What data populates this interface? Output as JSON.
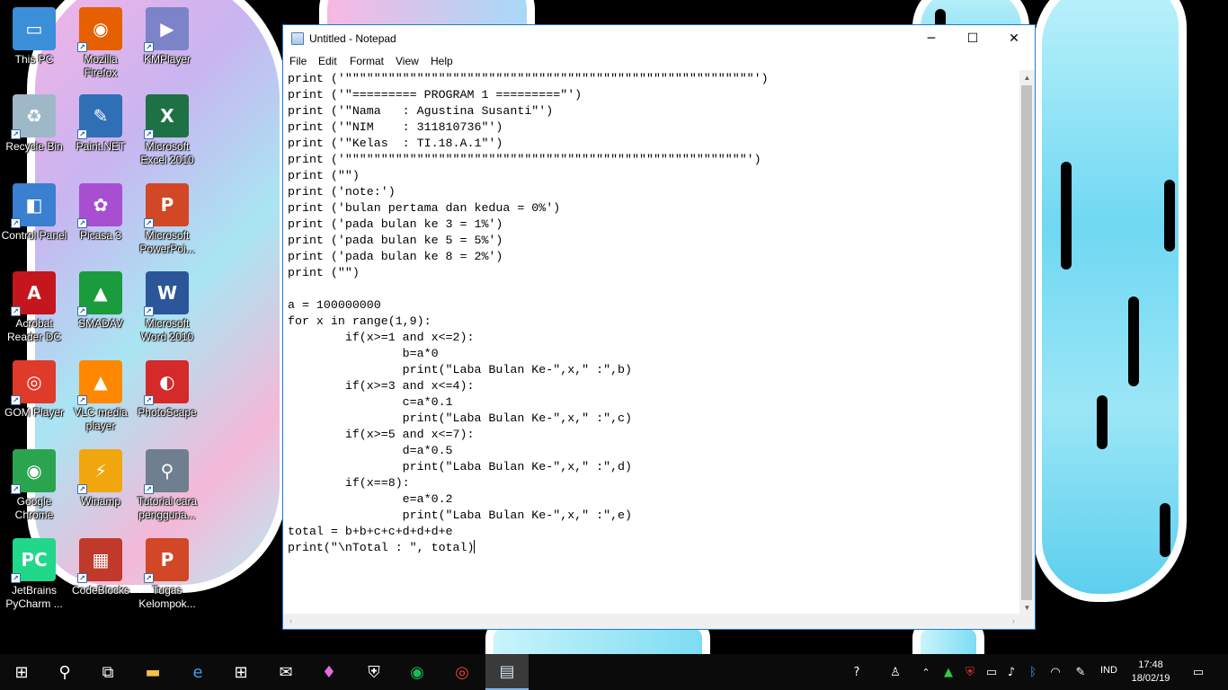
{
  "desktop": {
    "icons": [
      {
        "label": "This PC",
        "icon": "this-pc-icon",
        "color": "#3b8fd9",
        "glyph": "▭"
      },
      {
        "label": "Mozilla Firefox",
        "icon": "firefox-icon",
        "color": "#e66000",
        "glyph": "◉"
      },
      {
        "label": "KMPlayer",
        "icon": "kmplayer-icon",
        "color": "#7c83c9",
        "glyph": "▶"
      },
      {
        "label": "Recycle Bin",
        "icon": "recycle-bin-icon",
        "color": "#9fb8c8",
        "glyph": "♻"
      },
      {
        "label": "Paint.NET",
        "icon": "paintnet-icon",
        "color": "#2f6fb5",
        "glyph": "✎"
      },
      {
        "label": "Microsoft Excel 2010",
        "icon": "excel-icon",
        "color": "#1e7145",
        "glyph": "X"
      },
      {
        "label": "Control Panel",
        "icon": "control-panel-icon",
        "color": "#3a7fd0",
        "glyph": "◧"
      },
      {
        "label": "Picasa 3",
        "icon": "picasa-icon",
        "color": "#a74fd0",
        "glyph": "✿"
      },
      {
        "label": "Microsoft PowerPoi...",
        "icon": "powerpoint-icon",
        "color": "#d24726",
        "glyph": "P"
      },
      {
        "label": "Acrobat Reader DC",
        "icon": "acrobat-icon",
        "color": "#c4161c",
        "glyph": "A"
      },
      {
        "label": "SMADAV",
        "icon": "smadav-icon",
        "color": "#1a9b3c",
        "glyph": "▲"
      },
      {
        "label": "Microsoft Word 2010",
        "icon": "word-icon",
        "color": "#2b579a",
        "glyph": "W"
      },
      {
        "label": "GOM Player",
        "icon": "gom-player-icon",
        "color": "#e03a2a",
        "glyph": "◎"
      },
      {
        "label": "VLC media player",
        "icon": "vlc-icon",
        "color": "#ff8800",
        "glyph": "▲"
      },
      {
        "label": "PhotoScape",
        "icon": "photoscape-icon",
        "color": "#d42a2a",
        "glyph": "◐"
      },
      {
        "label": "Google Chrome",
        "icon": "chrome-icon",
        "color": "#2aa44f",
        "glyph": "◉"
      },
      {
        "label": "Winamp",
        "icon": "winamp-icon",
        "color": "#f2a60d",
        "glyph": "⚡"
      },
      {
        "label": "Tutorial cara pengguna...",
        "icon": "magnifier-icon",
        "color": "#6f7f8f",
        "glyph": "⚲"
      },
      {
        "label": "JetBrains PyCharm ...",
        "icon": "pycharm-icon",
        "color": "#21d789",
        "glyph": "PC"
      },
      {
        "label": "CodeBlocks",
        "icon": "codeblocks-icon",
        "color": "#c0392b",
        "glyph": "▦"
      },
      {
        "label": "Tugas Kelompok...",
        "icon": "pptx-file-icon",
        "color": "#d24726",
        "glyph": "P"
      }
    ]
  },
  "notepad": {
    "title": "Untitled - Notepad",
    "menu": [
      "File",
      "Edit",
      "Format",
      "View",
      "Help"
    ],
    "controls": {
      "minimize": "─",
      "maximize": "☐",
      "close": "✕"
    },
    "lines": [
      "print ('\"\"\"\"\"\"\"\"\"\"\"\"\"\"\"\"\"\"\"\"\"\"\"\"\"\"\"\"\"\"\"\"\"\"\"\"\"\"\"\"\"\"\"\"\"\"\"\"\"\"\"\"\"\"\"\"\"')",
      "print ('\"========= PROGRAM 1 =========\"')",
      "print ('\"Nama   : Agustina Susanti\"')",
      "print ('\"NIM    : 311810736\"')",
      "print ('\"Kelas  : TI.18.A.1\"')",
      "print ('\"\"\"\"\"\"\"\"\"\"\"\"\"\"\"\"\"\"\"\"\"\"\"\"\"\"\"\"\"\"\"\"\"\"\"\"\"\"\"\"\"\"\"\"\"\"\"\"\"\"\"\"\"\"\"\"')",
      "print (\"\")",
      "print ('note:')",
      "print ('bulan pertama dan kedua = 0%')",
      "print ('pada bulan ke 3 = 1%')",
      "print ('pada bulan ke 5 = 5%')",
      "print ('pada bulan ke 8 = 2%')",
      "print (\"\")",
      "",
      "a = 100000000",
      "for x in range(1,9):",
      "        if(x>=1 and x<=2):",
      "                b=a*0",
      "                print(\"Laba Bulan Ke-\",x,\" :\",b)",
      "        if(x>=3 and x<=4):",
      "                c=a*0.1",
      "                print(\"Laba Bulan Ke-\",x,\" :\",c)",
      "        if(x>=5 and x<=7):",
      "                d=a*0.5",
      "                print(\"Laba Bulan Ke-\",x,\" :\",d)",
      "        if(x==8):",
      "                e=a*0.2",
      "                print(\"Laba Bulan Ke-\",x,\" :\",e)",
      "total = b+b+c+c+d+d+d+e",
      "print(\"\\nTotal : \", total)"
    ]
  },
  "taskbar": {
    "items": [
      {
        "name": "start-button",
        "glyph": "⊞"
      },
      {
        "name": "search-button",
        "glyph": "⚲"
      },
      {
        "name": "task-view-button",
        "glyph": "⧉"
      },
      {
        "name": "file-explorer-taskbar",
        "glyph": "▬"
      },
      {
        "name": "edge-taskbar",
        "glyph": "e"
      },
      {
        "name": "store-taskbar",
        "glyph": "⊞"
      },
      {
        "name": "mail-taskbar",
        "glyph": "✉"
      },
      {
        "name": "maps-taskbar",
        "glyph": "♦"
      },
      {
        "name": "defender-taskbar",
        "glyph": "⛨"
      },
      {
        "name": "spotify-taskbar",
        "glyph": "◉"
      },
      {
        "name": "chrome-taskbar",
        "glyph": "◎"
      },
      {
        "name": "notepad-taskbar",
        "glyph": "▤"
      }
    ],
    "tray": {
      "language": "IND",
      "time": "17:48",
      "date": "18/02/19"
    }
  }
}
